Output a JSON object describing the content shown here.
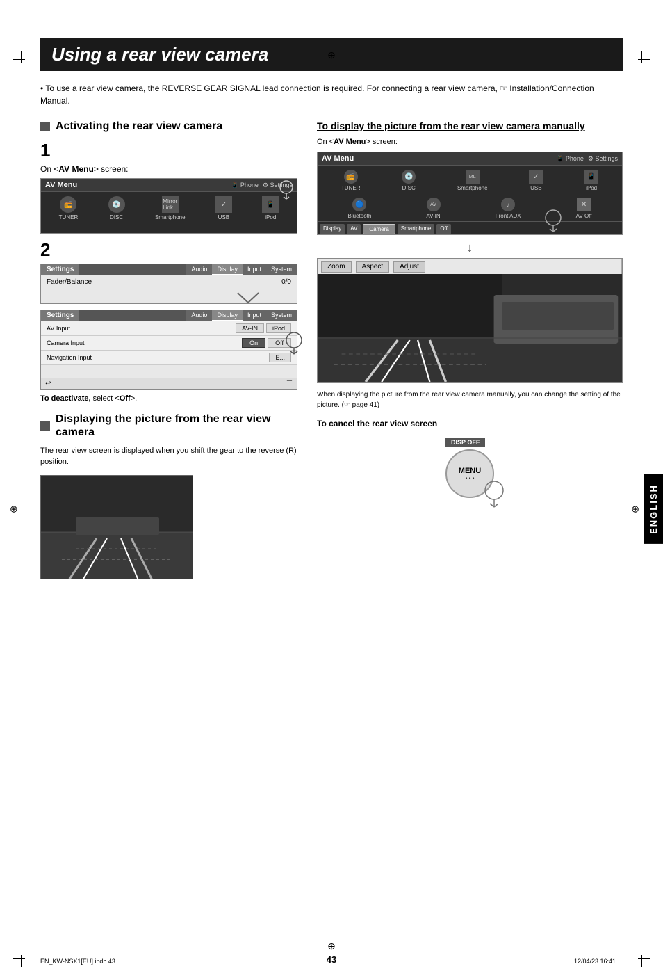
{
  "page": {
    "title": "Using a rear view camera",
    "page_number": "43",
    "footer_left": "EN_KW-NSX1[EU].indb   43",
    "footer_right": "12/04/23   16:41",
    "language_tab": "ENGLISH"
  },
  "intro": {
    "bullet": "To use a rear view camera, the REVERSE GEAR SIGNAL lead connection is required. For connecting a rear view camera,",
    "ref": "Installation/Connection Manual."
  },
  "left_col": {
    "section1": {
      "heading": "Activating the rear view camera",
      "step1": {
        "num": "1",
        "instruction": "On <AV Menu> screen:"
      },
      "av_menu_screen": {
        "title": "AV Menu",
        "phone_label": "Phone",
        "settings_label": "Settings",
        "icons": [
          "TUNER",
          "DISC",
          "Smartphone",
          "USB",
          "iPod"
        ]
      },
      "step2": {
        "num": "2"
      },
      "settings_screen1": {
        "title": "Settings",
        "tabs": [
          "Audio",
          "Display",
          "Input",
          "System"
        ],
        "row": "Fader/Balance",
        "value": "0/0"
      },
      "settings_screen2": {
        "title": "Settings",
        "tabs": [
          "Audio",
          "Display",
          "Input",
          "System"
        ],
        "rows": [
          {
            "label": "AV Input",
            "val1": "AV-IN",
            "val2": "iPod"
          },
          {
            "label": "Camera Input",
            "val1": "On",
            "val2": "Off"
          },
          {
            "label": "Navigation Input",
            "val1": "E..."
          }
        ]
      },
      "deactivate_note": "To deactivate, select <Off>."
    },
    "section2": {
      "heading": "Displaying the picture from the rear view camera",
      "text": "The rear view screen is displayed when you shift the gear to the reverse (R) position."
    }
  },
  "right_col": {
    "section_manual": {
      "heading": "To display the picture from the rear view camera manually",
      "sub_text": "On <AV Menu> screen:",
      "av_menu": {
        "title": "AV Menu",
        "phone_label": "Phone",
        "settings_label": "Settings",
        "icons": [
          "TUNER",
          "DISC",
          "Smartphone",
          "USB",
          "iPod"
        ],
        "icons2": [
          "Bluetooth",
          "AV-IN",
          "Front AUX",
          "AV Off"
        ],
        "bottom_row": [
          "Display",
          "AV",
          "Camera",
          "Smartphone",
          "Off"
        ]
      },
      "zoom_toolbar": [
        "Zoom",
        "Aspect",
        "Adjust"
      ],
      "caption": "When displaying the picture from the rear view camera manually, you can change the setting of the picture. (☞ page 41)"
    },
    "section_cancel": {
      "heading": "To cancel the rear view screen",
      "button_label": "DISP OFF",
      "button_text": "MENU",
      "button_dots": "• • •"
    }
  }
}
